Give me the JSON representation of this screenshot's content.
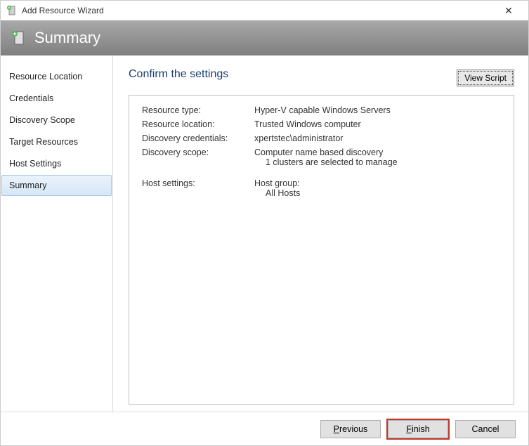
{
  "window": {
    "title": "Add Resource Wizard",
    "close": "✕"
  },
  "banner": {
    "title": "Summary"
  },
  "sidebar": {
    "items": [
      {
        "label": "Resource Location",
        "selected": false
      },
      {
        "label": "Credentials",
        "selected": false
      },
      {
        "label": "Discovery Scope",
        "selected": false
      },
      {
        "label": "Target Resources",
        "selected": false
      },
      {
        "label": "Host Settings",
        "selected": false
      },
      {
        "label": "Summary",
        "selected": true
      }
    ]
  },
  "content": {
    "title": "Confirm the settings",
    "view_script": "View Script",
    "rows": [
      {
        "label": "Resource type:",
        "value": "Hyper-V capable Windows Servers"
      },
      {
        "label": "Resource location:",
        "value": "Trusted Windows computer"
      },
      {
        "label": "Discovery credentials:",
        "value": "xpertstec\\administrator"
      },
      {
        "label": "Discovery scope:",
        "value": "Computer name based discovery",
        "sub": "1 clusters are selected to manage"
      },
      {
        "label": "Host settings:",
        "value": "Host group:",
        "sub": "All Hosts"
      }
    ]
  },
  "footer": {
    "previous": {
      "pre": "",
      "m": "P",
      "post": "revious"
    },
    "finish": {
      "pre": "",
      "m": "F",
      "post": "inish"
    },
    "cancel": {
      "text": "Cancel"
    }
  }
}
